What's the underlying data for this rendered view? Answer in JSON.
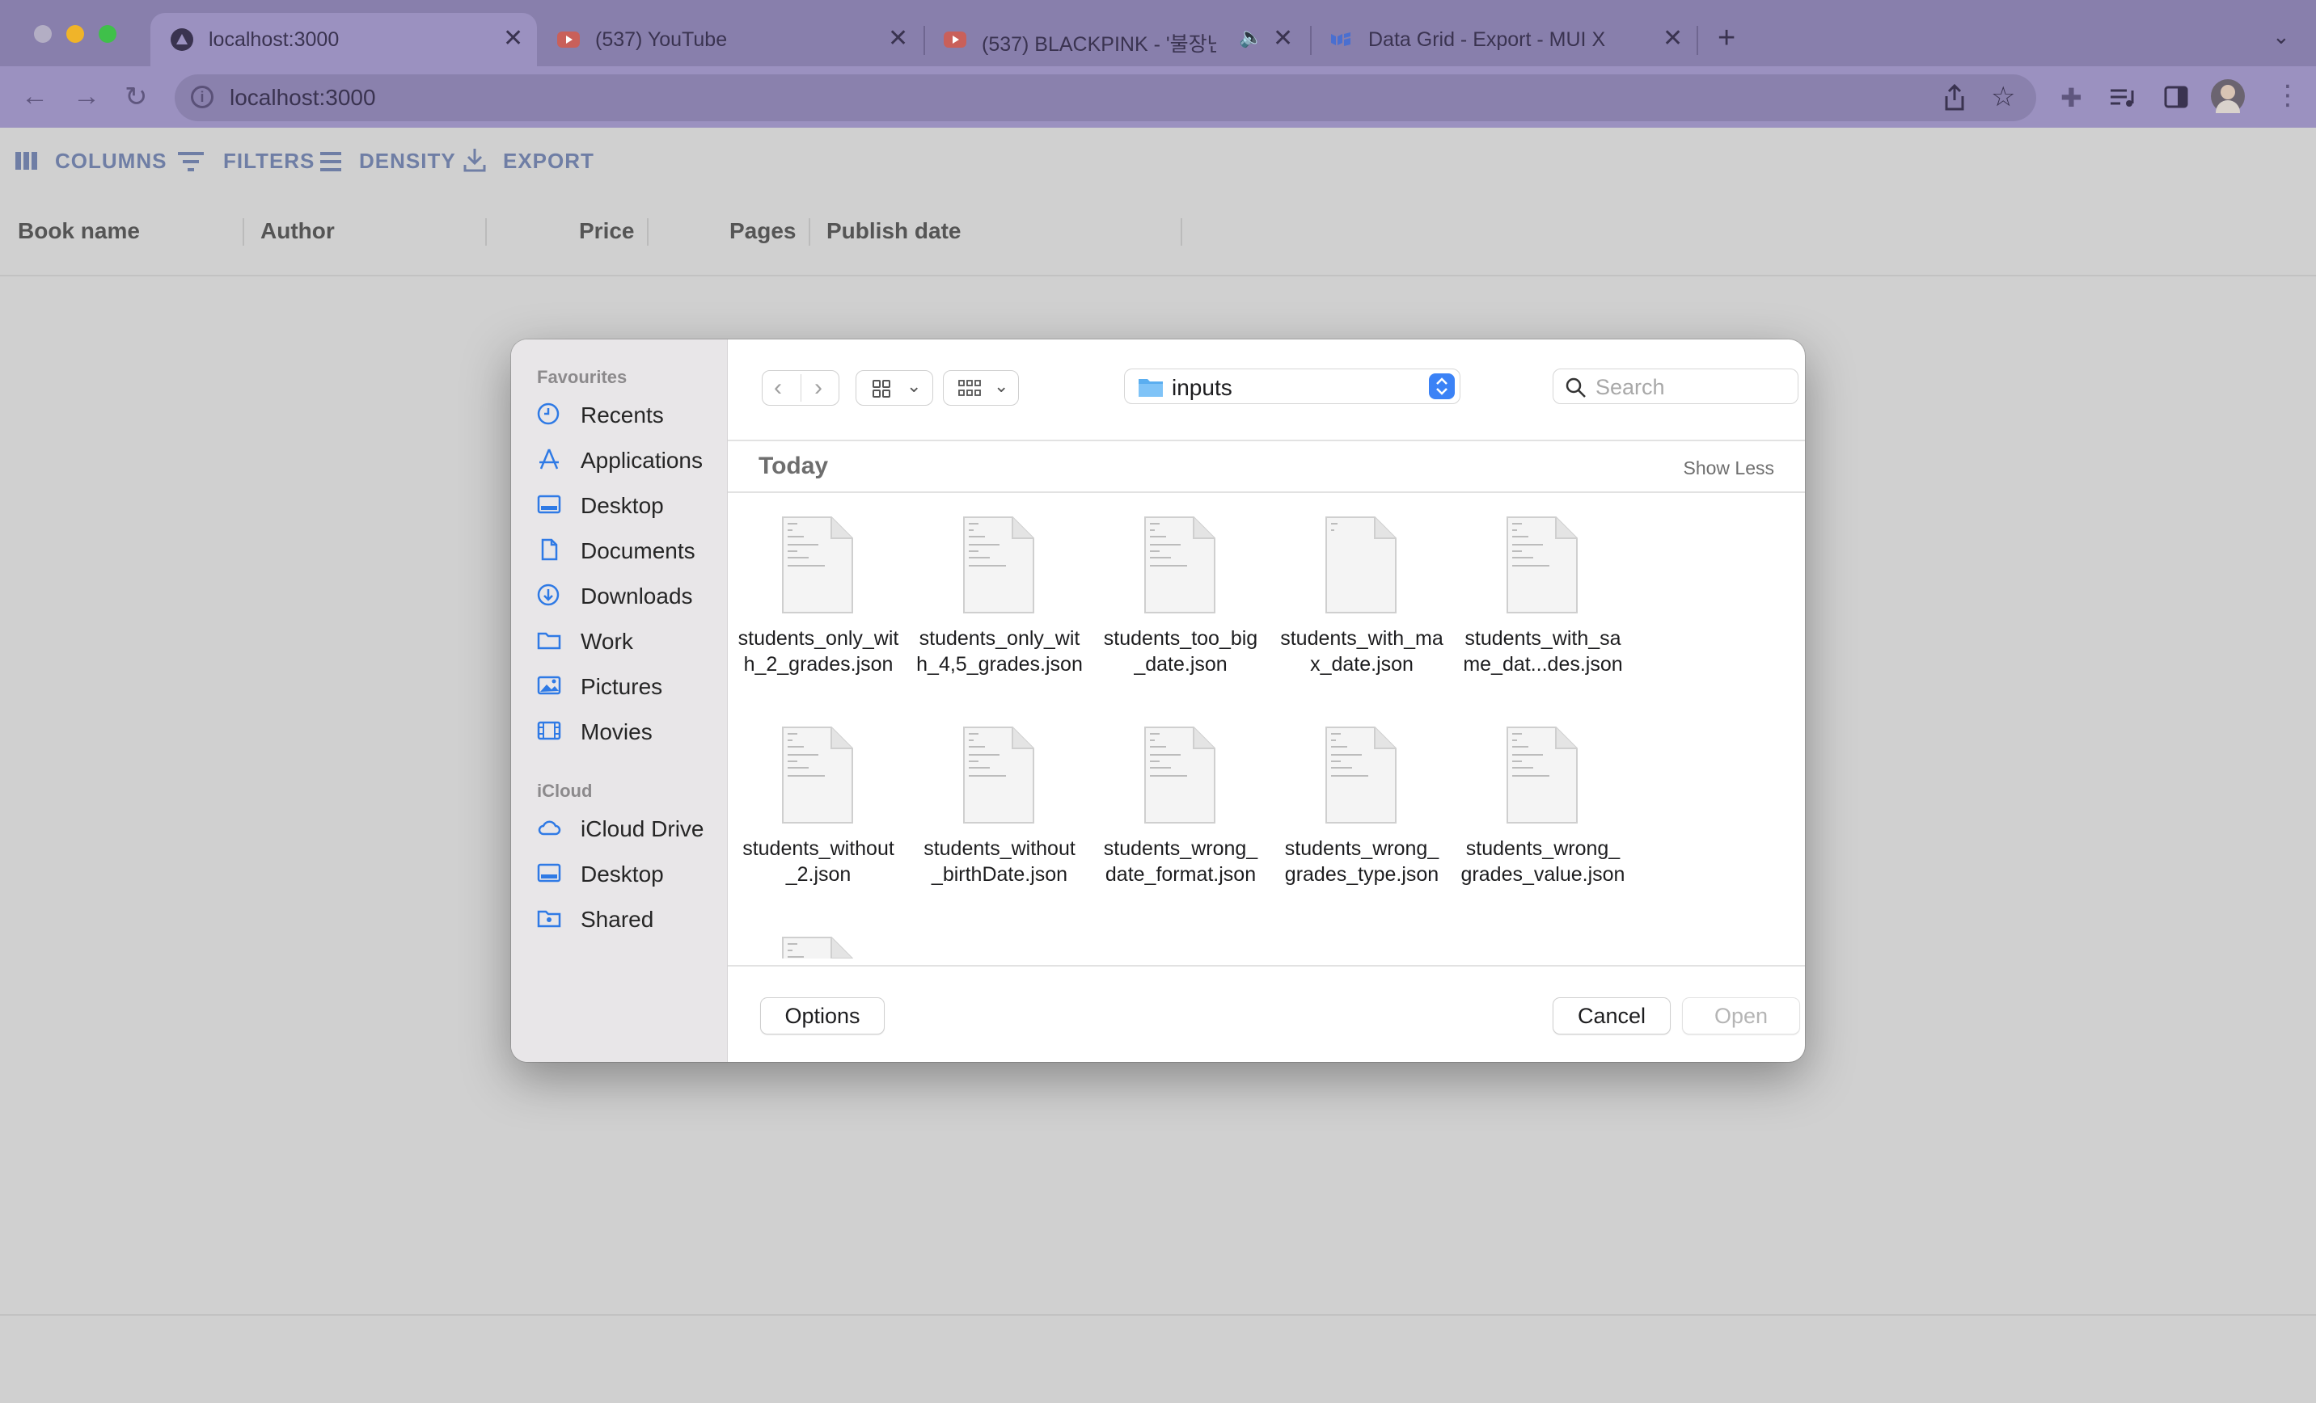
{
  "browser": {
    "tabs": [
      {
        "title": "localhost:3000",
        "active": true,
        "favicon": "triangle-logo-icon"
      },
      {
        "title": "(537) YouTube",
        "active": false,
        "favicon": "youtube-icon"
      },
      {
        "title": "(537) BLACKPINK - '불장난",
        "active": false,
        "favicon": "youtube-icon",
        "audio": true
      },
      {
        "title": "Data Grid - Export - MUI X",
        "active": false,
        "favicon": "mui-icon"
      }
    ],
    "new_tab": "+",
    "url": "localhost:3000",
    "colors": {
      "tabbar": "#887fac",
      "active_tab": "#9b91c0"
    }
  },
  "grid": {
    "toolbar": {
      "columns": "COLUMNS",
      "filters": "FILTERS",
      "density": "DENSITY",
      "export": "EXPORT"
    },
    "columns": [
      "Book name",
      "Author",
      "Price",
      "Pages",
      "Publish date"
    ]
  },
  "dialog": {
    "sidebar": {
      "favourites_header": "Favourites",
      "favourites": [
        {
          "label": "Recents",
          "icon": "clock-icon"
        },
        {
          "label": "Applications",
          "icon": "applications-icon"
        },
        {
          "label": "Desktop",
          "icon": "desktop-icon"
        },
        {
          "label": "Documents",
          "icon": "document-icon"
        },
        {
          "label": "Downloads",
          "icon": "download-icon"
        },
        {
          "label": "Work",
          "icon": "folder-icon"
        },
        {
          "label": "Pictures",
          "icon": "pictures-icon"
        },
        {
          "label": "Movies",
          "icon": "film-icon"
        }
      ],
      "icloud_header": "iCloud",
      "icloud": [
        {
          "label": "iCloud Drive",
          "icon": "cloud-icon"
        },
        {
          "label": "Desktop",
          "icon": "desktop-icon"
        },
        {
          "label": "Shared",
          "icon": "shared-folder-icon"
        }
      ]
    },
    "location": "inputs",
    "search_placeholder": "Search",
    "section": {
      "title": "Today",
      "toggle": "Show Less"
    },
    "files": [
      {
        "line1": "students_only_wit",
        "line2": "h_2_grades.json"
      },
      {
        "line1": "students_only_wit",
        "line2": "h_4,5_grades.json"
      },
      {
        "line1": "students_too_big",
        "line2": "_date.json"
      },
      {
        "line1": "students_with_ma",
        "line2": "x_date.json"
      },
      {
        "line1": "students_with_sa",
        "line2": "me_dat...des.json"
      },
      {
        "line1": "students_without",
        "line2": "_2.json"
      },
      {
        "line1": "students_without",
        "line2": "_birthDate.json"
      },
      {
        "line1": "students_wrong_",
        "line2": "date_format.json"
      },
      {
        "line1": "students_wrong_",
        "line2": "grades_type.json"
      },
      {
        "line1": "students_wrong_",
        "line2": "grades_value.json"
      }
    ],
    "buttons": {
      "options": "Options",
      "cancel": "Cancel",
      "open": "Open"
    },
    "accent": "#3b82f6"
  }
}
